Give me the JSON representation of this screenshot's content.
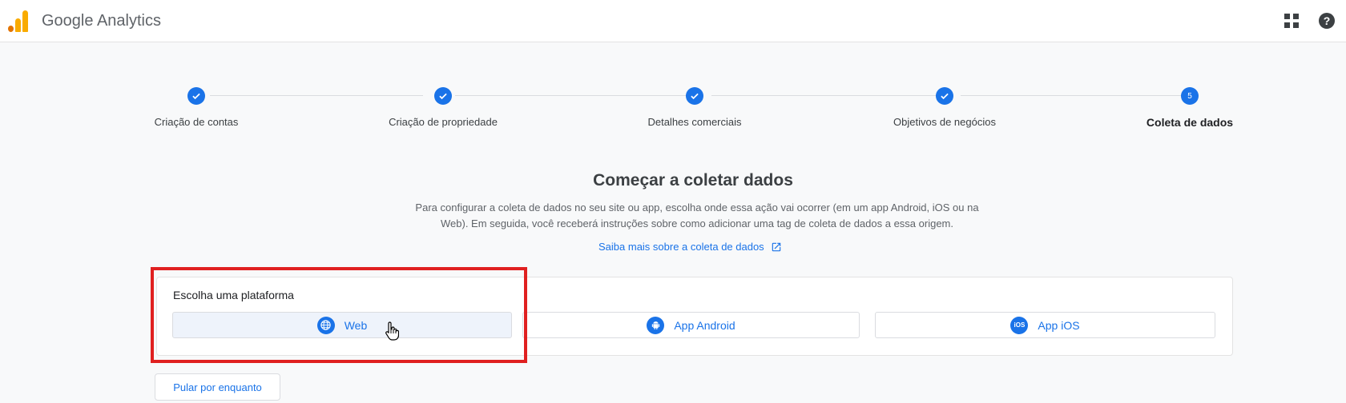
{
  "app": {
    "title": "Google Analytics"
  },
  "header_icons": {
    "apps": "apps-grid-icon",
    "help": "help-icon",
    "help_glyph": "?"
  },
  "colors": {
    "brand_blue": "#1a73e8",
    "logo_orange": "#f9ab00",
    "logo_dark_orange": "#e37400",
    "highlight_red": "#e02020"
  },
  "stepper": {
    "steps": [
      {
        "label": "Criação de contas",
        "state": "done"
      },
      {
        "label": "Criação de propriedade",
        "state": "done"
      },
      {
        "label": "Detalhes comerciais",
        "state": "done"
      },
      {
        "label": "Objetivos de negócios",
        "state": "done"
      },
      {
        "label": "Coleta de dados",
        "state": "active",
        "number": "5"
      }
    ]
  },
  "main": {
    "title": "Começar a coletar dados",
    "description": "Para configurar a coleta de dados no seu site ou app, escolha onde essa ação vai ocorrer (em um app Android, iOS ou na Web). Em seguida, você receberá instruções sobre como adicionar uma tag de coleta de dados a essa origem.",
    "learn_more": "Saiba mais sobre a coleta de dados"
  },
  "platform": {
    "label": "Escolha uma plataforma",
    "options": [
      {
        "label": "Web",
        "icon": "globe-icon",
        "selected": true
      },
      {
        "label": "App Android",
        "icon": "android-icon",
        "selected": false
      },
      {
        "label": "App iOS",
        "icon": "ios-icon",
        "icon_text": "iOS",
        "selected": false
      }
    ]
  },
  "skip_button": "Pular por enquanto"
}
